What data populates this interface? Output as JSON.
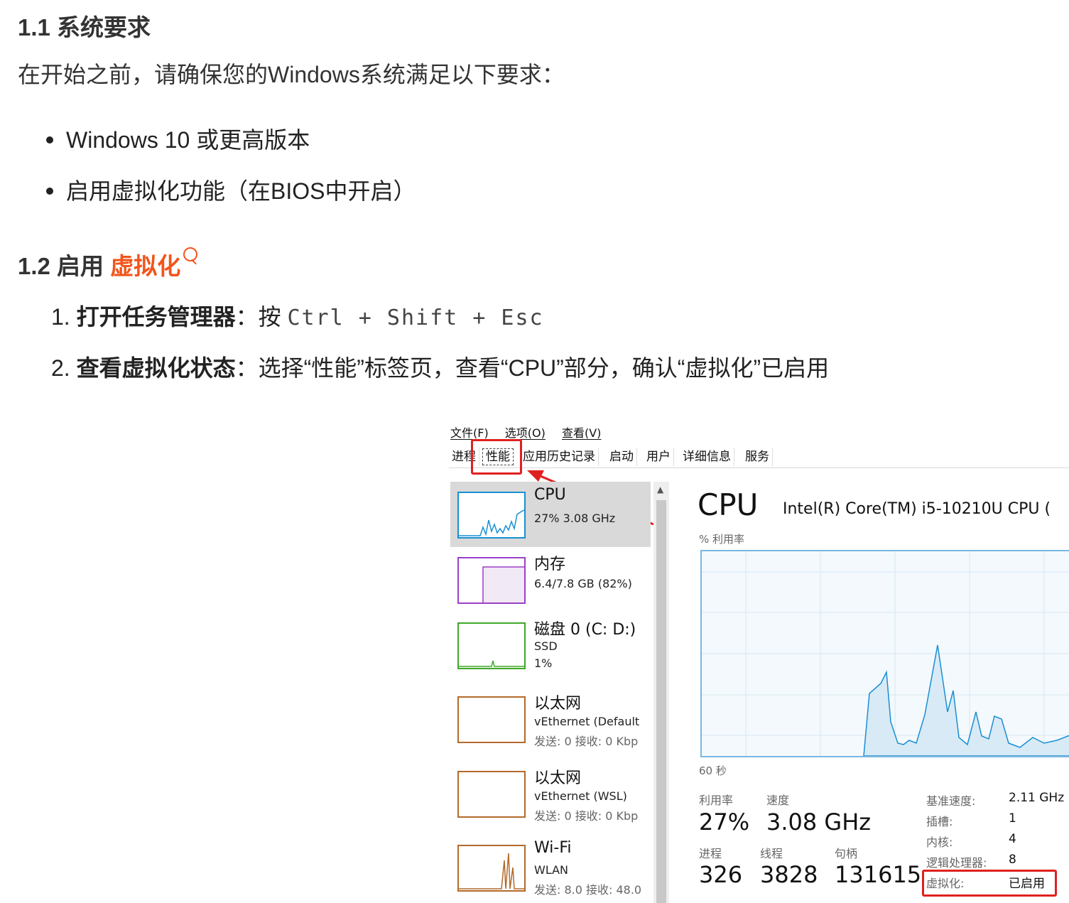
{
  "doc": {
    "h1": "1.1 系统要求",
    "intro": "在开始之前，请确保您的Windows系统满足以下要求：",
    "bullets": [
      "Windows 10 或更高版本",
      "启用虚拟化功能（在BIOS中开启）"
    ],
    "h2_prefix": "1.2 启用 ",
    "h2_highlight": "虚拟化",
    "steps": [
      {
        "num": "1.",
        "title": "打开任务管理器",
        "sep": "：按 ",
        "code": "Ctrl + Shift + Esc"
      },
      {
        "num": "2.",
        "title": "查看虚拟化状态",
        "sep": "：",
        "text": "选择“性能”标签页，查看“CPU”部分，确认“虚拟化”已启用"
      }
    ]
  },
  "taskmgr": {
    "menu": [
      "文件(F)",
      "选项(O)",
      "查看(V)"
    ],
    "tabs": [
      "进程",
      "性能",
      "应用历史记录",
      "启动",
      "用户",
      "详细信息",
      "服务"
    ],
    "sidebar": [
      {
        "name": "CPU",
        "sub1": "27% 3.08 GHz",
        "color": "#1a8fd3"
      },
      {
        "name": "内存",
        "sub1": "6.4/7.8 GB (82%)",
        "color": "#9c3fc8"
      },
      {
        "name": "磁盘 0 (C: D:)",
        "sub1": "SSD",
        "sub2": "1%",
        "color": "#3fa829"
      },
      {
        "name": "以太网",
        "sub1": "vEthernet (Default",
        "sub2": "发送: 0 接收: 0 Kbp",
        "color": "#b36a2a"
      },
      {
        "name": "以太网",
        "sub1": "vEthernet (WSL)",
        "sub2": "发送: 0 接收: 0 Kbp",
        "color": "#b36a2a"
      },
      {
        "name": "Wi-Fi",
        "sub1": "WLAN",
        "sub2": "发送: 8.0 接收: 48.0",
        "color": "#b36a2a"
      }
    ],
    "cpu_title": "CPU",
    "cpu_model": "Intel(R) Core(TM) i5-10210U CPU (",
    "util_label": "% 利用率",
    "seconds_label": "60 秒",
    "stats": {
      "util_label": "利用率",
      "util": "27%",
      "speed_label": "速度",
      "speed": "3.08 GHz",
      "proc_label": "进程",
      "proc": "326",
      "thread_label": "线程",
      "thread": "3828",
      "handle_label": "句柄",
      "handle": "131615"
    },
    "right": [
      {
        "k": "基准速度:",
        "v": "2.11 GHz"
      },
      {
        "k": "插槽:",
        "v": "1"
      },
      {
        "k": "内核:",
        "v": "4"
      },
      {
        "k": "逻辑处理器:",
        "v": "8"
      },
      {
        "k": "虚拟化:",
        "v": "已启用"
      }
    ]
  }
}
